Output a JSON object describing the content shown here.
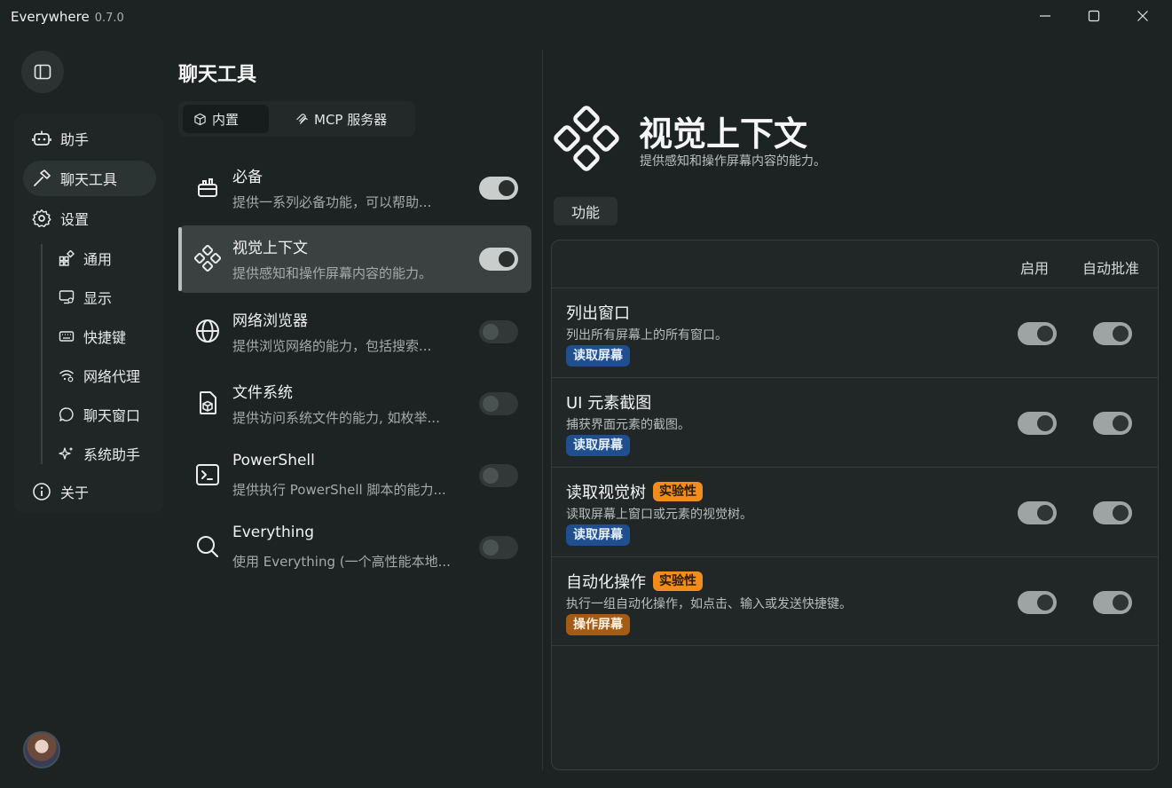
{
  "app": {
    "title": "Everywhere",
    "version": "0.7.0"
  },
  "nav": {
    "items": [
      {
        "label": "助手"
      },
      {
        "label": "聊天工具"
      },
      {
        "label": "设置"
      }
    ],
    "sub": [
      {
        "label": "通用"
      },
      {
        "label": "显示"
      },
      {
        "label": "快捷键"
      },
      {
        "label": "网络代理"
      },
      {
        "label": "聊天窗口"
      },
      {
        "label": "系统助手"
      }
    ],
    "about": "关于"
  },
  "tools": {
    "title": "聊天工具",
    "tabs": [
      {
        "label": "内置"
      },
      {
        "label": "MCP 服务器"
      }
    ],
    "list": [
      {
        "name": "必备",
        "desc": "提供一系列必备功能，可以帮助...",
        "enabled": true
      },
      {
        "name": "视觉上下文",
        "desc": "提供感知和操作屏幕内容的能力。",
        "enabled": true
      },
      {
        "name": "网络浏览器",
        "desc": "提供浏览网络的能力，包括搜索...",
        "enabled": false
      },
      {
        "name": "文件系统",
        "desc": "提供访问系统文件的能力, 如枚举...",
        "enabled": false
      },
      {
        "name": "PowerShell",
        "desc": "提供执行 PowerShell 脚本的能力...",
        "enabled": false
      },
      {
        "name": "Everything",
        "desc": "使用 Everything (一个高性能本地...",
        "enabled": false
      }
    ]
  },
  "detail": {
    "title": "视觉上下文",
    "desc": "提供感知和操作屏幕内容的能力。",
    "section": "功能",
    "columns": {
      "enable": "启用",
      "auto_approve": "自动批准"
    },
    "functions": [
      {
        "name": "列出窗口",
        "desc": "列出所有屏幕上的所有窗口。",
        "tag": "读取屏幕",
        "experimental": ""
      },
      {
        "name": "UI 元素截图",
        "desc": "捕获界面元素的截图。",
        "tag": "读取屏幕",
        "experimental": ""
      },
      {
        "name": "读取视觉树",
        "desc": "读取屏幕上窗口或元素的视觉树。",
        "tag": "读取屏幕",
        "experimental": "实验性"
      },
      {
        "name": "自动化操作",
        "desc": "执行一组自动化操作，如点击、输入或发送快捷键。",
        "tag": "操作屏幕",
        "experimental": "实验性"
      }
    ]
  },
  "colors": {
    "background": "#1c2322",
    "badge_read": "#1f4f8e",
    "badge_operate": "#a65b14",
    "badge_experimental": "#f28c1a"
  }
}
